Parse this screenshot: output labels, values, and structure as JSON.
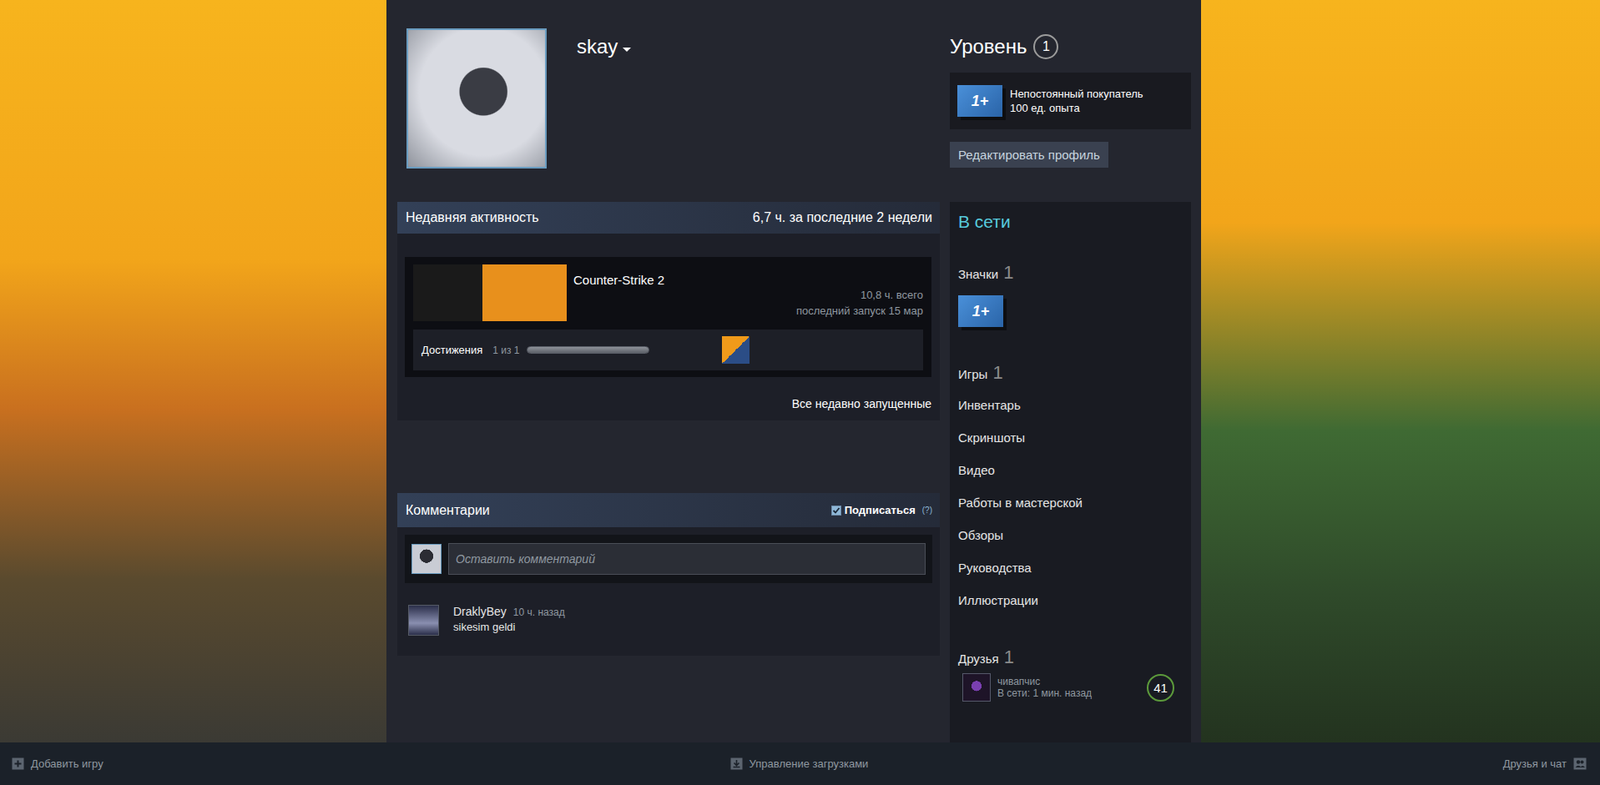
{
  "profile": {
    "name": "skay"
  },
  "level": {
    "label": "Уровень",
    "value": "1"
  },
  "featured_badge": {
    "icon_text": "1+",
    "title": "Непостоянный покупатель",
    "xp": "100 ед. опыта"
  },
  "edit_button": "Редактировать профиль",
  "recent_activity": {
    "title": "Недавняя активность",
    "summary": "6,7 ч. за последние 2 недели",
    "games": [
      {
        "name": "Counter-Strike 2",
        "hours_total": "10,8 ч. всего",
        "last_played": "последний запуск 15 мар",
        "achievements": {
          "label": "Достижения",
          "count": "1 из 1",
          "level": 1
        }
      }
    ],
    "view_all": "Все недавно запущенные"
  },
  "comments": {
    "title": "Комментарии",
    "subscribe": {
      "label": "Подписаться",
      "checked": true
    },
    "help": "(?)",
    "placeholder": "Оставить комментарий",
    "items": [
      {
        "author": "DraklyBey",
        "time": "10 ч. назад",
        "text": "sikesim geldi"
      }
    ]
  },
  "sidebar": {
    "status": "В сети",
    "badges": {
      "label": "Значки",
      "count": "1",
      "icon_text": "1+"
    },
    "games": {
      "label": "Игры",
      "count": "1"
    },
    "links": [
      "Инвентарь",
      "Скриншоты",
      "Видео",
      "Работы в мастерской",
      "Обзоры",
      "Руководства",
      "Иллюстрации"
    ],
    "friends": {
      "label": "Друзья",
      "count": "1",
      "items": [
        {
          "name": "чивапчис",
          "status": "В сети: 1 мин. назад",
          "level": "41"
        }
      ]
    }
  },
  "bottom_bar": {
    "add_game": "Добавить игру",
    "downloads": "Управление загрузками",
    "friends_chat": "Друзья и чат"
  }
}
